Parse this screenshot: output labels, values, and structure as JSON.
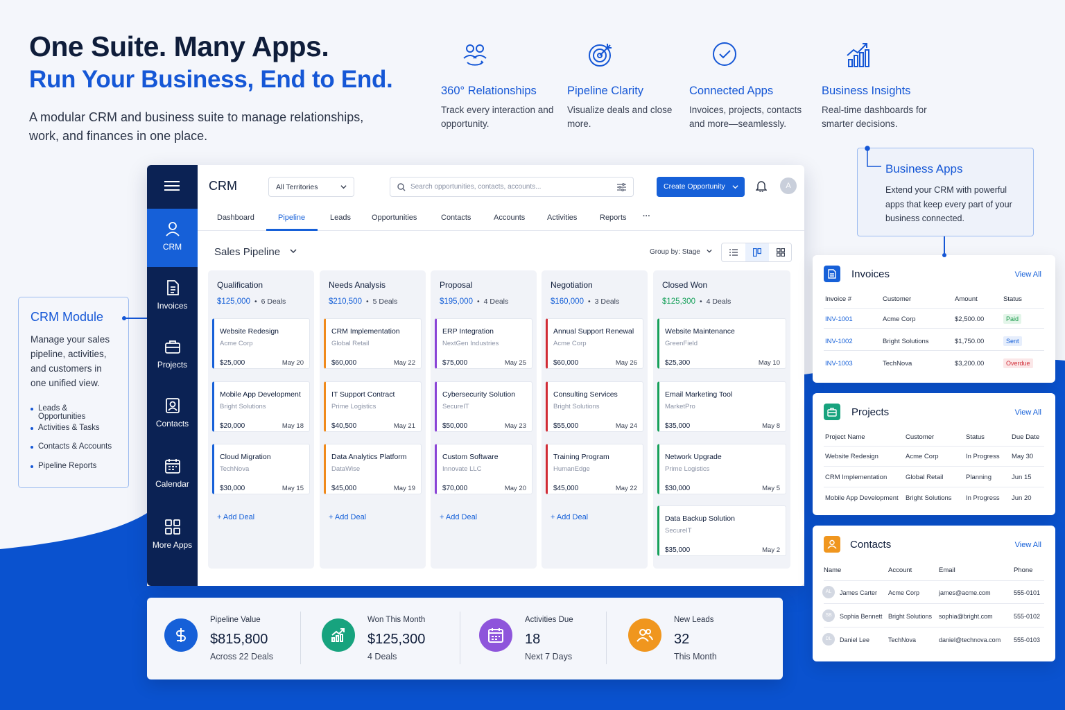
{
  "hero": {
    "title": "One Suite. Many Apps.",
    "subtitle": "Run Your Business, End to End.",
    "description": "A modular CRM and business suite to manage relationships, work, and finances in one place."
  },
  "features": [
    {
      "icon": "relationships-icon",
      "title": "360° Relationships",
      "desc": "Track every interaction and opportunity."
    },
    {
      "icon": "target-icon",
      "title": "Pipeline Clarity",
      "desc": "Visualize deals and close more."
    },
    {
      "icon": "check-circle-icon",
      "title": "Connected Apps",
      "desc": "Invoices, projects, contacts and more—seamlessly."
    },
    {
      "icon": "bar-chart-icon",
      "title": "Business Insights",
      "desc": "Real-time dashboards for smarter decisions."
    }
  ],
  "colors": {
    "accent": "#1660d8",
    "sidebar": "#0b2254",
    "blue_bg": "#0a52cf"
  },
  "sidebar": {
    "items": [
      {
        "label": "CRM",
        "icon": "user-icon"
      },
      {
        "label": "Invoices",
        "icon": "document-icon"
      },
      {
        "label": "Projects",
        "icon": "briefcase-icon"
      },
      {
        "label": "Contacts",
        "icon": "contact-card-icon"
      },
      {
        "label": "Calendar",
        "icon": "calendar-icon"
      },
      {
        "label": "More Apps",
        "icon": "grid-icon"
      }
    ]
  },
  "app": {
    "title": "CRM",
    "territory": "All Territories",
    "search_placeholder": "Search opportunities, contacts, accounts...",
    "create_label": "Create Opportunity",
    "avatar": "A",
    "tabs": [
      "Dashboard",
      "Pipeline",
      "Leads",
      "Opportunities",
      "Contacts",
      "Accounts",
      "Activities",
      "Reports"
    ],
    "more_tabs": "···",
    "pipeline_title": "Sales Pipeline",
    "group_by": "Group by: Stage",
    "add_deal": "+ Add Deal"
  },
  "pipeline": [
    {
      "stage": "Qualification",
      "amount": "$125,000",
      "deals": "6 Deals",
      "color": "#1660d8",
      "amount_color": "#1660d8",
      "cards": [
        {
          "title": "Website Redesign",
          "company": "Acme Corp",
          "value": "$25,000",
          "date": "May 20"
        },
        {
          "title": "Mobile App Development",
          "company": "Bright Solutions",
          "value": "$20,000",
          "date": "May 18"
        },
        {
          "title": "Cloud Migration",
          "company": "TechNova",
          "value": "$30,000",
          "date": "May 15"
        }
      ]
    },
    {
      "stage": "Needs Analysis",
      "amount": "$210,500",
      "deals": "5 Deals",
      "color": "#f08a1c",
      "amount_color": "#1660d8",
      "cards": [
        {
          "title": "CRM Implementation",
          "company": "Global Retail",
          "value": "$60,000",
          "date": "May 22"
        },
        {
          "title": "IT Support Contract",
          "company": "Prime Logistics",
          "value": "$40,500",
          "date": "May 21"
        },
        {
          "title": "Data Analytics Platform",
          "company": "DataWise",
          "value": "$45,000",
          "date": "May 19"
        }
      ]
    },
    {
      "stage": "Proposal",
      "amount": "$195,000",
      "deals": "4 Deals",
      "color": "#8a44d6",
      "amount_color": "#1660d8",
      "cards": [
        {
          "title": "ERP Integration",
          "company": "NextGen Industries",
          "value": "$75,000",
          "date": "May 25"
        },
        {
          "title": "Cybersecurity Solution",
          "company": "SecureIT",
          "value": "$50,000",
          "date": "May 23"
        },
        {
          "title": "Custom Software",
          "company": "Innovate LLC",
          "value": "$70,000",
          "date": "May 20"
        }
      ]
    },
    {
      "stage": "Negotiation",
      "amount": "$160,000",
      "deals": "3 Deals",
      "color": "#d12b35",
      "amount_color": "#1660d8",
      "cards": [
        {
          "title": "Annual Support Renewal",
          "company": "Acme Corp",
          "value": "$60,000",
          "date": "May 26"
        },
        {
          "title": "Consulting Services",
          "company": "Bright Solutions",
          "value": "$55,000",
          "date": "May 24"
        },
        {
          "title": "Training Program",
          "company": "HumanEdge",
          "value": "$45,000",
          "date": "May 22"
        }
      ]
    },
    {
      "stage": "Closed Won",
      "amount": "$125,300",
      "deals": "4 Deals",
      "color": "#16a05a",
      "amount_color": "#16a05a",
      "cards": [
        {
          "title": "Website Maintenance",
          "company": "GreenField",
          "value": "$25,300",
          "date": "May 10"
        },
        {
          "title": "Email Marketing Tool",
          "company": "MarketPro",
          "value": "$35,000",
          "date": "May 8"
        },
        {
          "title": "Network Upgrade",
          "company": "Prime Logistics",
          "value": "$30,000",
          "date": "May 5"
        },
        {
          "title": "Data Backup Solution",
          "company": "SecureIT",
          "value": "$35,000",
          "date": "May 2"
        }
      ]
    }
  ],
  "kpis": [
    {
      "label": "Pipeline Value",
      "value": "$815,800",
      "sub": "Across 22 Deals",
      "icon": "dollar-icon",
      "color": "#1660d8"
    },
    {
      "label": "Won This Month",
      "value": "$125,300",
      "sub": "4 Deals",
      "icon": "trend-up-icon",
      "color": "#17a37e"
    },
    {
      "label": "Activities Due",
      "value": "18",
      "sub": "Next 7 Days",
      "icon": "calendar-icon",
      "color": "#8e55db"
    },
    {
      "label": "New Leads",
      "value": "32",
      "sub": "This Month",
      "icon": "users-icon",
      "color": "#f0961e"
    }
  ],
  "crm_module": {
    "title": "CRM Module",
    "desc": "Manage your sales pipeline, activities, and customers in one unified view.",
    "bullets": [
      "Leads & Opportunities",
      "Activities & Tasks",
      "Contacts & Accounts",
      "Pipeline Reports"
    ]
  },
  "business_apps": {
    "title": "Business Apps",
    "desc": "Extend your CRM with powerful apps that keep every part of your business connected."
  },
  "invoices": {
    "title": "Invoices",
    "view_all": "View All",
    "headers": [
      "Invoice #",
      "Customer",
      "Amount",
      "Status"
    ],
    "rows": [
      {
        "id": "INV-1001",
        "customer": "Acme Corp",
        "amount": "$2,500.00",
        "status": "Paid",
        "status_color": "#1a9b4b",
        "status_bg": "#e3f5e9"
      },
      {
        "id": "INV-1002",
        "customer": "Bright Solutions",
        "amount": "$1,750.00",
        "status": "Sent",
        "status_color": "#1660d8",
        "status_bg": "#e6eefc"
      },
      {
        "id": "INV-1003",
        "customer": "TechNova",
        "amount": "$3,200.00",
        "status": "Overdue",
        "status_color": "#d12b35",
        "status_bg": "#fbe7e8"
      }
    ]
  },
  "projects": {
    "title": "Projects",
    "view_all": "View All",
    "headers": [
      "Project Name",
      "Customer",
      "Status",
      "Due Date"
    ],
    "rows": [
      {
        "name": "Website Redesign",
        "customer": "Acme Corp",
        "status": "In Progress",
        "due": "May 30"
      },
      {
        "name": "CRM Implementation",
        "customer": "Global Retail",
        "status": "Planning",
        "due": "Jun 15"
      },
      {
        "name": "Mobile App Development",
        "customer": "Bright Solutions",
        "status": "In Progress",
        "due": "Jun 20"
      }
    ]
  },
  "contacts": {
    "title": "Contacts",
    "view_all": "View All",
    "headers": [
      "Name",
      "Account",
      "Email",
      "Phone"
    ],
    "rows": [
      {
        "initials": "AL",
        "name": "James Carter",
        "account": "Acme Corp",
        "email": "james@acme.com",
        "phone": "555-0101"
      },
      {
        "initials": "SB",
        "name": "Sophia Bennett",
        "account": "Bright Solutions",
        "email": "sophia@bright.com",
        "phone": "555-0102"
      },
      {
        "initials": "DL",
        "name": "Daniel Lee",
        "account": "TechNova",
        "email": "daniel@technova.com",
        "phone": "555-0103"
      }
    ]
  }
}
